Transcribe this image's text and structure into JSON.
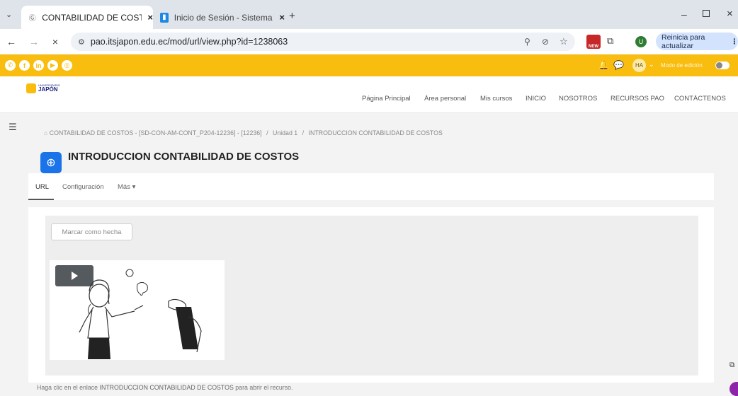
{
  "browser": {
    "tabs": [
      {
        "title": "CONTABILIDAD DE COSTOS - [",
        "active": true,
        "icon": "moodle-icon"
      },
      {
        "title": "Inicio de Sesión - Sistema Gest",
        "active": false,
        "icon": "book-icon"
      }
    ],
    "new_tab": "+",
    "url": "pao.itsjapon.edu.ec/mod/url/view.php?id=1238063",
    "update_button": "Reinicia para actualizar",
    "profile_initial": "U"
  },
  "site": {
    "social_icons": [
      "whatsapp-icon",
      "facebook-icon",
      "linkedin-icon",
      "youtube-icon",
      "instagram-icon"
    ],
    "user_initials": "HA",
    "edit_mode_label": "Modo de edición",
    "logo_text": "JAPÓN",
    "logo_small": "UNIVERSITARIO",
    "nav": [
      "Página Principal",
      "Área personal",
      "Mis cursos",
      "INICIO",
      "NOSOTROS",
      "RECURSOS PAO",
      "CONTÁCTENOS"
    ]
  },
  "page": {
    "breadcrumb": {
      "course": "CONTABILIDAD DE COSTOS - [SD-CON-AM-CONT_P204-12236] - [12236]",
      "separator": "/",
      "unit": "Unidad 1",
      "current": "INTRODUCCION CONTABILIDAD DE COSTOS"
    },
    "title": "INTRODUCCION CONTABILIDAD DE COSTOS",
    "tabs": [
      "URL",
      "Configuración",
      "Más ▾"
    ],
    "mark_done": "Marcar como hecha",
    "click_text_prefix": "Haga clic en el enlace ",
    "click_link": "INTRODUCCION CONTABILIDAD DE COSTOS",
    "click_text_suffix": " para abrir el recurso."
  },
  "colors": {
    "accent_yellow": "#f9bd10",
    "page_icon_blue": "#1a73e8"
  }
}
